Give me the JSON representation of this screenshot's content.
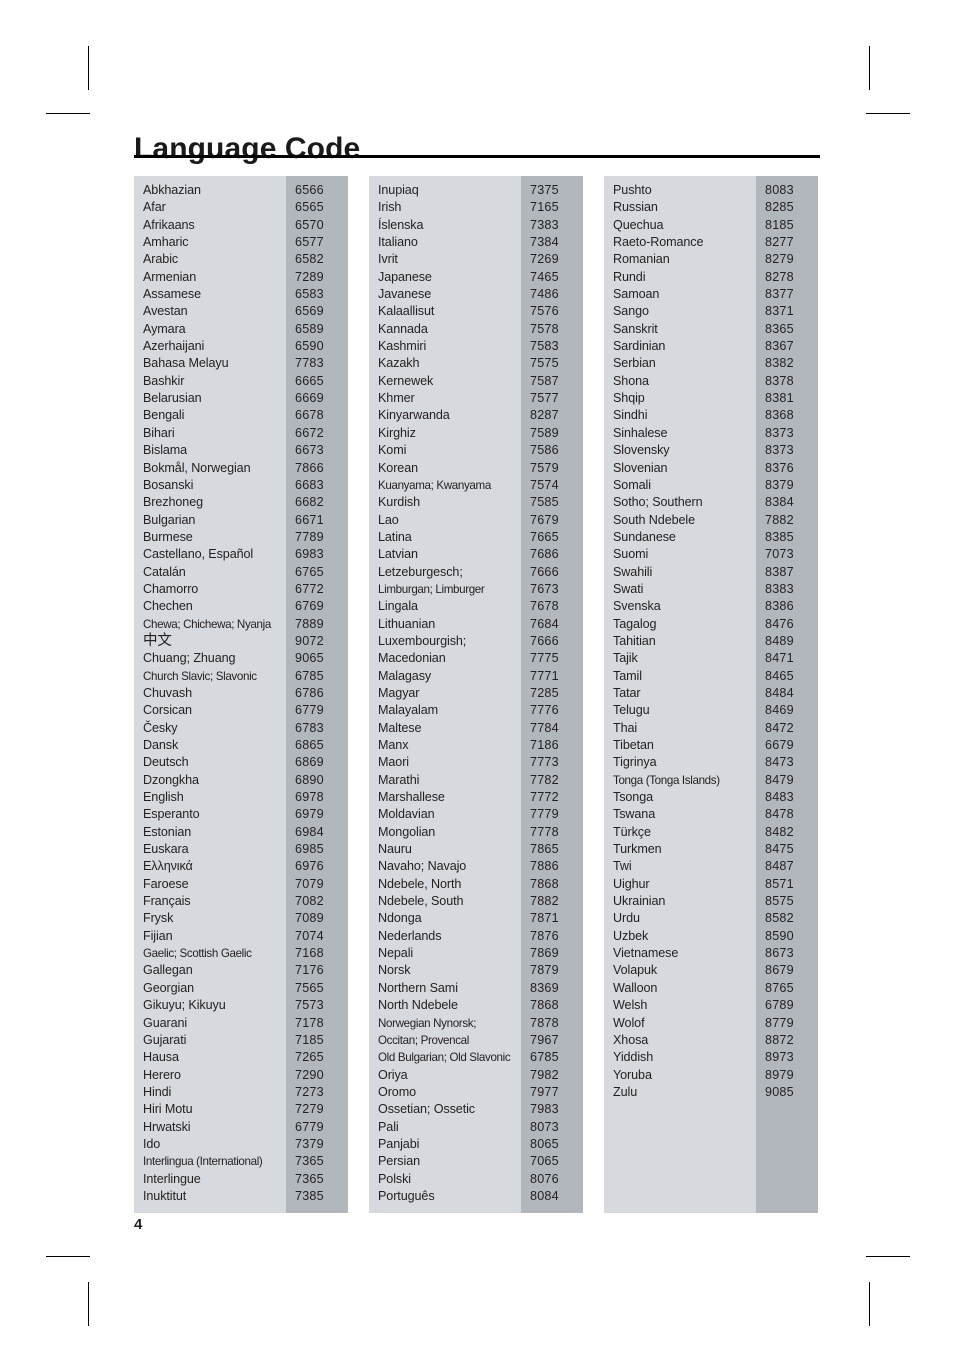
{
  "page": {
    "title": "Language Code",
    "number": "4"
  },
  "colors": {
    "name_band": "#d6d9dd",
    "code_band": "#b1b7bd",
    "text": "#231f20",
    "rule": "#000000"
  },
  "table": {
    "columns": [
      {
        "id": "column-1",
        "rows": [
          {
            "name": "Abkhazian",
            "code": "6566"
          },
          {
            "name": "Afar",
            "code": "6565"
          },
          {
            "name": "Afrikaans",
            "code": "6570"
          },
          {
            "name": "Amharic",
            "code": "6577"
          },
          {
            "name": "Arabic",
            "code": "6582"
          },
          {
            "name": "Armenian",
            "code": "7289"
          },
          {
            "name": "Assamese",
            "code": "6583"
          },
          {
            "name": "Avestan",
            "code": "6569"
          },
          {
            "name": "Aymara",
            "code": "6589"
          },
          {
            "name": "Azerhaijani",
            "code": "6590"
          },
          {
            "name": "Bahasa Melayu",
            "code": "7783"
          },
          {
            "name": "Bashkir",
            "code": "6665"
          },
          {
            "name": "Belarusian",
            "code": "6669"
          },
          {
            "name": "Bengali",
            "code": "6678"
          },
          {
            "name": "Bihari",
            "code": "6672"
          },
          {
            "name": "Bislama",
            "code": "6673"
          },
          {
            "name": "Bokmål, Norwegian",
            "code": "7866"
          },
          {
            "name": "Bosanski",
            "code": "6683"
          },
          {
            "name": "Brezhoneg",
            "code": "6682"
          },
          {
            "name": "Bulgarian",
            "code": "6671"
          },
          {
            "name": "Burmese",
            "code": "7789"
          },
          {
            "name": "Castellano, Español",
            "code": "6983"
          },
          {
            "name": "Catalán",
            "code": "6765"
          },
          {
            "name": "Chamorro",
            "code": "6772"
          },
          {
            "name": "Chechen",
            "code": "6769"
          },
          {
            "name": "Chewa; Chichewa; Nyanja",
            "code": "7889",
            "tight": true
          },
          {
            "name": "中文",
            "code": "9072",
            "cjk": true
          },
          {
            "name": "Chuang; Zhuang",
            "code": "9065"
          },
          {
            "name": "Church Slavic; Slavonic",
            "code": "6785",
            "tight": true
          },
          {
            "name": "Chuvash",
            "code": "6786"
          },
          {
            "name": "Corsican",
            "code": "6779"
          },
          {
            "name": "Česky",
            "code": "6783"
          },
          {
            "name": "Dansk",
            "code": "6865"
          },
          {
            "name": "Deutsch",
            "code": "6869"
          },
          {
            "name": "Dzongkha",
            "code": "6890"
          },
          {
            "name": "English",
            "code": "6978"
          },
          {
            "name": "Esperanto",
            "code": "6979"
          },
          {
            "name": "Estonian",
            "code": "6984"
          },
          {
            "name": "Euskara",
            "code": "6985"
          },
          {
            "name": "Ελληνικά",
            "code": "6976"
          },
          {
            "name": "Faroese",
            "code": "7079"
          },
          {
            "name": "Français",
            "code": "7082"
          },
          {
            "name": "Frysk",
            "code": "7089"
          },
          {
            "name": "Fijian",
            "code": "7074"
          },
          {
            "name": "Gaelic; Scottish Gaelic",
            "code": "7168",
            "tight": true
          },
          {
            "name": "Gallegan",
            "code": "7176"
          },
          {
            "name": "Georgian",
            "code": "7565"
          },
          {
            "name": "Gikuyu; Kikuyu",
            "code": "7573"
          },
          {
            "name": "Guarani",
            "code": "7178"
          },
          {
            "name": "Gujarati",
            "code": "7185"
          },
          {
            "name": "Hausa",
            "code": "7265"
          },
          {
            "name": "Herero",
            "code": "7290"
          },
          {
            "name": "Hindi",
            "code": "7273"
          },
          {
            "name": "Hiri Motu",
            "code": "7279"
          },
          {
            "name": "Hrwatski",
            "code": "6779"
          },
          {
            "name": "Ido",
            "code": "7379"
          },
          {
            "name": "Interlingua (International)",
            "code": "7365",
            "tight": true
          },
          {
            "name": "Interlingue",
            "code": "7365"
          },
          {
            "name": "Inuktitut",
            "code": "7385"
          }
        ]
      },
      {
        "id": "column-2",
        "rows": [
          {
            "name": "Inupiaq",
            "code": "7375"
          },
          {
            "name": "Irish",
            "code": "7165"
          },
          {
            "name": "Íslenska",
            "code": "7383"
          },
          {
            "name": "Italiano",
            "code": "7384"
          },
          {
            "name": "Ivrit",
            "code": "7269"
          },
          {
            "name": "Japanese",
            "code": "7465"
          },
          {
            "name": "Javanese",
            "code": "7486"
          },
          {
            "name": "Kalaallisut",
            "code": "7576"
          },
          {
            "name": "Kannada",
            "code": "7578"
          },
          {
            "name": "Kashmiri",
            "code": "7583"
          },
          {
            "name": "Kazakh",
            "code": "7575"
          },
          {
            "name": "Kernewek",
            "code": "7587"
          },
          {
            "name": "Khmer",
            "code": "7577"
          },
          {
            "name": "Kinyarwanda",
            "code": "8287"
          },
          {
            "name": "Kirghiz",
            "code": "7589"
          },
          {
            "name": "Komi",
            "code": "7586"
          },
          {
            "name": "Korean",
            "code": "7579"
          },
          {
            "name": "Kuanyama; Kwanyama",
            "code": "7574",
            "tight": true
          },
          {
            "name": "Kurdish",
            "code": "7585"
          },
          {
            "name": "Lao",
            "code": "7679"
          },
          {
            "name": "Latina",
            "code": "7665"
          },
          {
            "name": "Latvian",
            "code": "7686"
          },
          {
            "name": "Letzeburgesch;",
            "code": "7666"
          },
          {
            "name": "Limburgan; Limburger",
            "code": "7673",
            "tight": true
          },
          {
            "name": "Lingala",
            "code": "7678"
          },
          {
            "name": "Lithuanian",
            "code": "7684"
          },
          {
            "name": "Luxembourgish;",
            "code": "7666"
          },
          {
            "name": "Macedonian",
            "code": "7775"
          },
          {
            "name": "Malagasy",
            "code": "7771"
          },
          {
            "name": "Magyar",
            "code": "7285"
          },
          {
            "name": "Malayalam",
            "code": "7776"
          },
          {
            "name": "Maltese",
            "code": "7784"
          },
          {
            "name": "Manx",
            "code": "7186"
          },
          {
            "name": "Maori",
            "code": "7773"
          },
          {
            "name": "Marathi",
            "code": "7782"
          },
          {
            "name": "Marshallese",
            "code": "7772"
          },
          {
            "name": "Moldavian",
            "code": "7779"
          },
          {
            "name": "Mongolian",
            "code": "7778"
          },
          {
            "name": "Nauru",
            "code": "7865"
          },
          {
            "name": "Navaho; Navajo",
            "code": "7886"
          },
          {
            "name": "Ndebele, North",
            "code": "7868"
          },
          {
            "name": "Ndebele, South",
            "code": "7882"
          },
          {
            "name": "Ndonga",
            "code": "7871"
          },
          {
            "name": "Nederlands",
            "code": "7876"
          },
          {
            "name": "Nepali",
            "code": "7869"
          },
          {
            "name": "Norsk",
            "code": "7879"
          },
          {
            "name": "Northern Sami",
            "code": "8369"
          },
          {
            "name": "North Ndebele",
            "code": "7868"
          },
          {
            "name": "Norwegian Nynorsk;",
            "code": "7878",
            "tight": true
          },
          {
            "name": "Occitan; Provencal",
            "code": "7967",
            "tight": true
          },
          {
            "name": "Old Bulgarian; Old Slavonic",
            "code": "6785",
            "tight": true
          },
          {
            "name": "Oriya",
            "code": "7982"
          },
          {
            "name": "Oromo",
            "code": "7977"
          },
          {
            "name": "Ossetian; Ossetic",
            "code": "7983"
          },
          {
            "name": "Pali",
            "code": "8073"
          },
          {
            "name": "Panjabi",
            "code": "8065"
          },
          {
            "name": "Persian",
            "code": "7065"
          },
          {
            "name": "Polski",
            "code": "8076"
          },
          {
            "name": "Português",
            "code": "8084"
          }
        ]
      },
      {
        "id": "column-3",
        "rows": [
          {
            "name": "Pushto",
            "code": "8083"
          },
          {
            "name": "Russian",
            "code": "8285"
          },
          {
            "name": "Quechua",
            "code": "8185"
          },
          {
            "name": "Raeto-Romance",
            "code": "8277"
          },
          {
            "name": "Romanian",
            "code": "8279"
          },
          {
            "name": "Rundi",
            "code": "8278"
          },
          {
            "name": "Samoan",
            "code": "8377"
          },
          {
            "name": "Sango",
            "code": "8371"
          },
          {
            "name": "Sanskrit",
            "code": "8365"
          },
          {
            "name": "Sardinian",
            "code": "8367"
          },
          {
            "name": "Serbian",
            "code": "8382"
          },
          {
            "name": "Shona",
            "code": "8378"
          },
          {
            "name": "Shqip",
            "code": "8381"
          },
          {
            "name": "Sindhi",
            "code": "8368"
          },
          {
            "name": "Sinhalese",
            "code": "8373"
          },
          {
            "name": "Slovensky",
            "code": "8373"
          },
          {
            "name": "Slovenian",
            "code": "8376"
          },
          {
            "name": "Somali",
            "code": "8379"
          },
          {
            "name": "Sotho; Southern",
            "code": "8384"
          },
          {
            "name": "South Ndebele",
            "code": "7882"
          },
          {
            "name": "Sundanese",
            "code": "8385"
          },
          {
            "name": "Suomi",
            "code": "7073"
          },
          {
            "name": "Swahili",
            "code": "8387"
          },
          {
            "name": "Swati",
            "code": "8383"
          },
          {
            "name": "Svenska",
            "code": "8386"
          },
          {
            "name": "Tagalog",
            "code": "8476"
          },
          {
            "name": "Tahitian",
            "code": "8489"
          },
          {
            "name": "Tajik",
            "code": "8471"
          },
          {
            "name": "Tamil",
            "code": "8465"
          },
          {
            "name": "Tatar",
            "code": "8484"
          },
          {
            "name": "Telugu",
            "code": "8469"
          },
          {
            "name": "Thai",
            "code": "8472"
          },
          {
            "name": "Tibetan",
            "code": "6679"
          },
          {
            "name": "Tigrinya",
            "code": "8473"
          },
          {
            "name": "Tonga (Tonga Islands)",
            "code": "8479",
            "tight": true
          },
          {
            "name": "Tsonga",
            "code": "8483"
          },
          {
            "name": "Tswana",
            "code": "8478"
          },
          {
            "name": "Türkçe",
            "code": "8482"
          },
          {
            "name": "Turkmen",
            "code": "8475"
          },
          {
            "name": "Twi",
            "code": "8487"
          },
          {
            "name": "Uighur",
            "code": "8571"
          },
          {
            "name": "Ukrainian",
            "code": "8575"
          },
          {
            "name": "Urdu",
            "code": "8582"
          },
          {
            "name": "Uzbek",
            "code": "8590"
          },
          {
            "name": "Vietnamese",
            "code": "8673"
          },
          {
            "name": "Volapuk",
            "code": "8679"
          },
          {
            "name": "Walloon",
            "code": "8765"
          },
          {
            "name": "Welsh",
            "code": "6789"
          },
          {
            "name": "Wolof",
            "code": "8779"
          },
          {
            "name": "Xhosa",
            "code": "8872"
          },
          {
            "name": "Yiddish",
            "code": "8973"
          },
          {
            "name": "Yoruba",
            "code": "8979"
          },
          {
            "name": "Zulu",
            "code": "9085"
          }
        ]
      }
    ]
  }
}
